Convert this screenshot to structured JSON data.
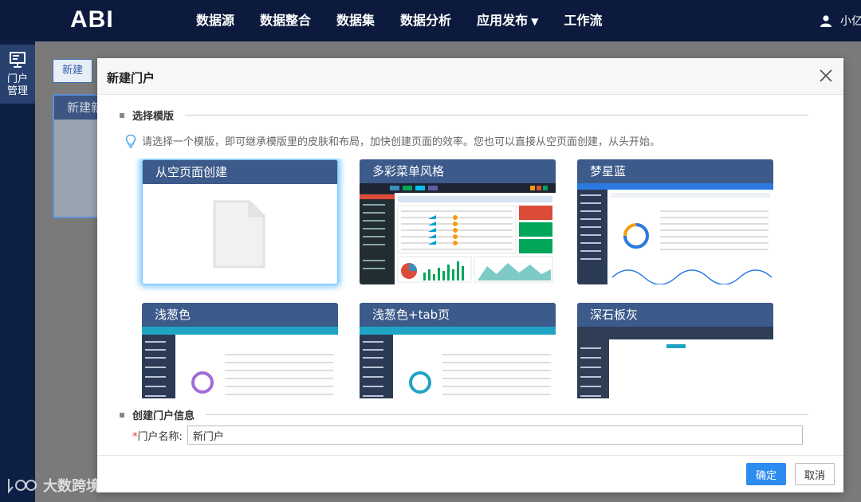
{
  "header": {
    "logo": "ABI",
    "nav": [
      {
        "label": "数据源"
      },
      {
        "label": "数据整合"
      },
      {
        "label": "数据集"
      },
      {
        "label": "数据分析"
      },
      {
        "label": "应用发布",
        "caret": "▼"
      },
      {
        "label": "工作流"
      }
    ],
    "user_name": "小亿"
  },
  "sidebar": {
    "active_label_1": "门户",
    "active_label_2": "管理"
  },
  "background_page": {
    "new_button": "新建",
    "card_title": "新建新"
  },
  "modal": {
    "title": "新建门户",
    "section_template": "选择模版",
    "tip": "请选择一个模版，即可继承模版里的皮肤和布局，加快创建页面的效率。您也可以直接从空页面创建，从头开始。",
    "templates": [
      {
        "name": "从空页面创建",
        "selected": true
      },
      {
        "name": "多彩菜单风格",
        "selected": false
      },
      {
        "name": "梦星蓝",
        "selected": false
      },
      {
        "name": "浅葱色",
        "selected": false
      },
      {
        "name": "浅葱色+tab页",
        "selected": false
      },
      {
        "name": "深石板灰",
        "selected": false
      }
    ],
    "section_info": "创建门户信息",
    "name_label_required": "*",
    "name_label": "门户名称:",
    "name_value": "新门户",
    "ok_button": "确定",
    "cancel_button": "取消"
  },
  "watermark": "大数跨境",
  "colors": {
    "nav_bg": "#0b1a3d",
    "template_header": "#3c5a8a",
    "primary": "#2d8cf0",
    "selected_glow": "#7cc6ff"
  }
}
